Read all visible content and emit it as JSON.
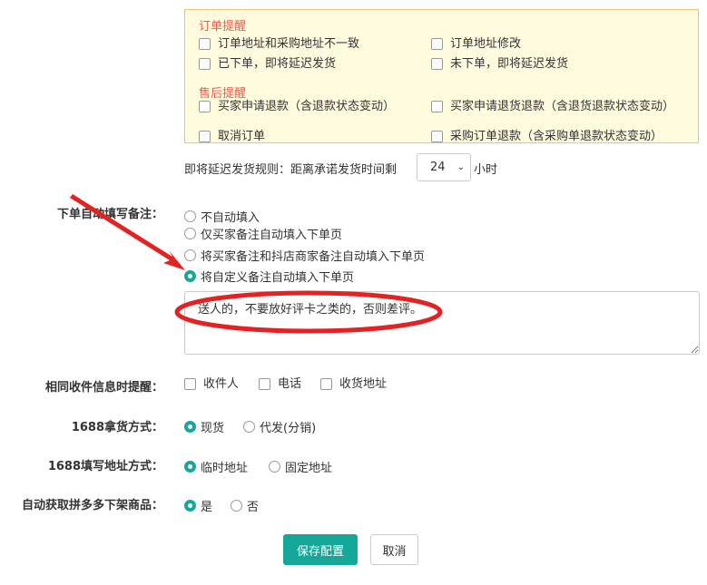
{
  "order_alerts": {
    "title": "订单提醒",
    "items": [
      "订单地址和采购地址不一致",
      "订单地址修改",
      "已下单，即将延迟发货",
      "未下单，即将延迟发货"
    ]
  },
  "after_sale_alerts": {
    "title": "售后提醒",
    "items": [
      "买家申请退款（含退款状态变动）",
      "买家申请退货退款（含退货退款状态变动）",
      "取消订单",
      "采购订单退款（含采购单退款状态变动）"
    ]
  },
  "delay_rule": {
    "label": "即将延迟发货规则：距离承诺发货时间剩",
    "value": "24",
    "unit": "小时"
  },
  "auto_remark": {
    "label": "下单自动填写备注：",
    "options": [
      "不自动填入",
      "仅买家备注自动填入下单页",
      "将买家备注和抖店商家备注自动填入下单页",
      "将自定义备注自动填入下单页"
    ],
    "selected": 3,
    "text": "送人的，不要放好评卡之类的，否则差评。"
  },
  "same_info": {
    "label": "相同收件信息时提醒：",
    "options": [
      "收件人",
      "电话",
      "收货地址"
    ]
  },
  "pickup": {
    "label": "1688拿货方式：",
    "options": [
      "现货",
      "代发(分销)"
    ],
    "selected": 0
  },
  "address": {
    "label": "1688填写地址方式：",
    "options": [
      "临时地址",
      "固定地址"
    ],
    "selected": 0
  },
  "pdd": {
    "label": "自动获取拼多多下架商品：",
    "options": [
      "是",
      "否"
    ],
    "selected": 0
  },
  "buttons": {
    "save": "保存配置",
    "cancel": "取消"
  },
  "colors": {
    "accent": "#15a79a",
    "annotation": "#e52222"
  }
}
